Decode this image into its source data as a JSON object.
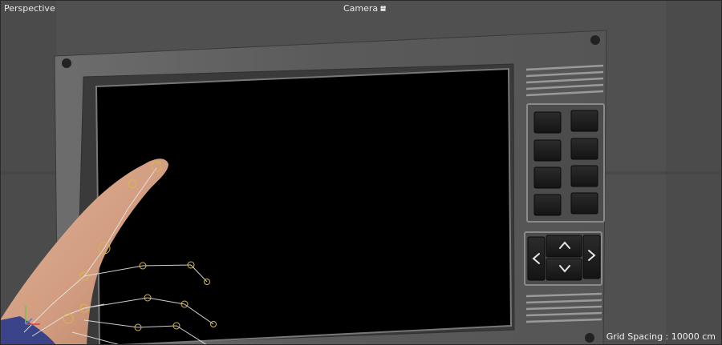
{
  "viewport": {
    "name": "Perspective",
    "camera_label": "Camera",
    "camera_icon": "camera-icon",
    "grid_spacing_label": "Grid Spacing : 10000 cm"
  },
  "panel": {
    "nav_icons": [
      "arrow-up-icon",
      "arrow-left-icon",
      "arrow-right-icon",
      "arrow-down-icon"
    ]
  }
}
